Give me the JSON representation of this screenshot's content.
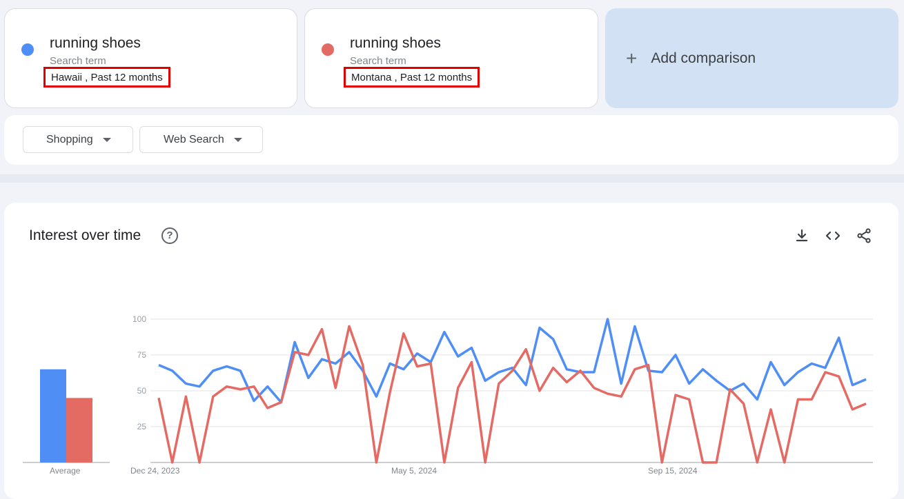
{
  "terms": [
    {
      "name": "running shoes",
      "sub": "Search term",
      "location": "Hawaii , Past 12 months",
      "color": "#4f8ef5"
    },
    {
      "name": "running shoes",
      "sub": "Search term",
      "location": "Montana , Past 12 months",
      "color": "#e46a64"
    }
  ],
  "add_comparison": {
    "icon": "plus-icon",
    "label": "Add comparison"
  },
  "filters": {
    "category": "Shopping",
    "property": "Web Search"
  },
  "chart": {
    "title": "Interest over time",
    "icons": [
      "help-icon",
      "download-icon",
      "embed-icon",
      "share-icon"
    ]
  },
  "chart_data": {
    "type": "line",
    "x_tick_labels": [
      "Dec 24, 2023",
      "May 5, 2024",
      "Sep 15, 2024"
    ],
    "y_ticks": [
      100,
      75,
      50,
      25
    ],
    "ylim": [
      0,
      100
    ],
    "grid": true,
    "average_label": "Average",
    "averages": [
      65,
      45
    ],
    "series": [
      {
        "color": "#4f8ef5",
        "values": [
          68,
          64,
          55,
          53,
          64,
          67,
          64,
          43,
          53,
          42,
          84,
          59,
          72,
          69,
          77,
          64,
          46,
          69,
          65,
          76,
          70,
          91,
          74,
          80,
          57,
          63,
          66,
          54,
          94,
          86,
          65,
          63,
          63,
          100,
          55,
          95,
          64,
          63,
          75,
          55,
          65,
          57,
          50,
          55,
          44,
          70,
          54,
          63,
          69,
          66,
          87,
          54,
          58
        ]
      },
      {
        "color": "#e46a64",
        "values": [
          45,
          0,
          46,
          0,
          46,
          53,
          51,
          53,
          38,
          42,
          77,
          75,
          93,
          52,
          95,
          68,
          0,
          49,
          90,
          67,
          69,
          0,
          52,
          70,
          0,
          55,
          64,
          79,
          50,
          66,
          56,
          64,
          52,
          48,
          46,
          65,
          68,
          0,
          47,
          44,
          0,
          0,
          51,
          41,
          0,
          37,
          0,
          44,
          44,
          63,
          60,
          37,
          41
        ]
      }
    ]
  }
}
